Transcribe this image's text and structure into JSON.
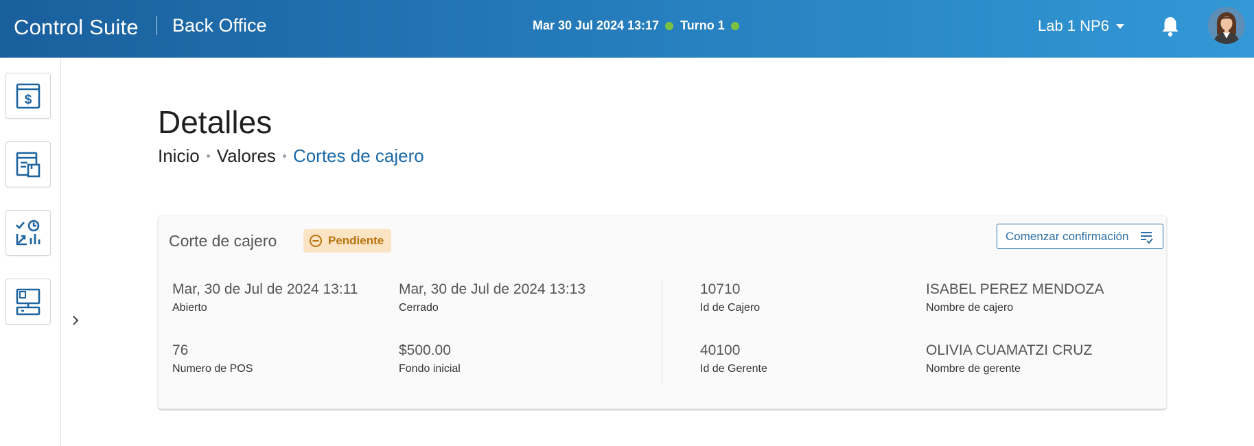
{
  "header": {
    "brand": "Control Suite",
    "module": "Back Office",
    "datetime": "Mar 30 Jul 2024 13:17",
    "shift": "Turno 1",
    "store": "Lab 1 NP6",
    "status_color": "#7cc242"
  },
  "sidebar": {
    "items": [
      {
        "name": "cash-register-icon"
      },
      {
        "name": "inventory-icon"
      },
      {
        "name": "reports-icon"
      },
      {
        "name": "terminal-settings-icon"
      }
    ]
  },
  "page": {
    "title": "Detalles",
    "breadcrumb": [
      "Inicio",
      "Valores",
      "Cortes de cajero"
    ]
  },
  "card": {
    "title": "Corte de cajero",
    "status": "Pendiente",
    "confirm_button": "Comenzar confirmación",
    "fields": {
      "opened": {
        "value": "Mar, 30 de Jul de 2024 13:11",
        "label": "Abierto"
      },
      "closed": {
        "value": "Mar, 30 de Jul de 2024 13:13",
        "label": "Cerrado"
      },
      "cashier_id": {
        "value": "10710",
        "label": "Id de Cajero"
      },
      "cashier_name": {
        "value": "ISABEL PEREZ MENDOZA",
        "label": "Nombre de cajero"
      },
      "pos_number": {
        "value": "76",
        "label": "Numero de POS"
      },
      "initial_fund": {
        "value": "$500.00",
        "label": "Fondo inicial"
      },
      "manager_id": {
        "value": "40100",
        "label": "Id de Gerente"
      },
      "manager_name": {
        "value": "OLIVIA CUAMATZI CRUZ",
        "label": "Nombre de gerente"
      }
    }
  },
  "colors": {
    "accent": "#1b6aa8",
    "badge_bg": "#fbe4c4",
    "badge_text": "#b8740f"
  }
}
